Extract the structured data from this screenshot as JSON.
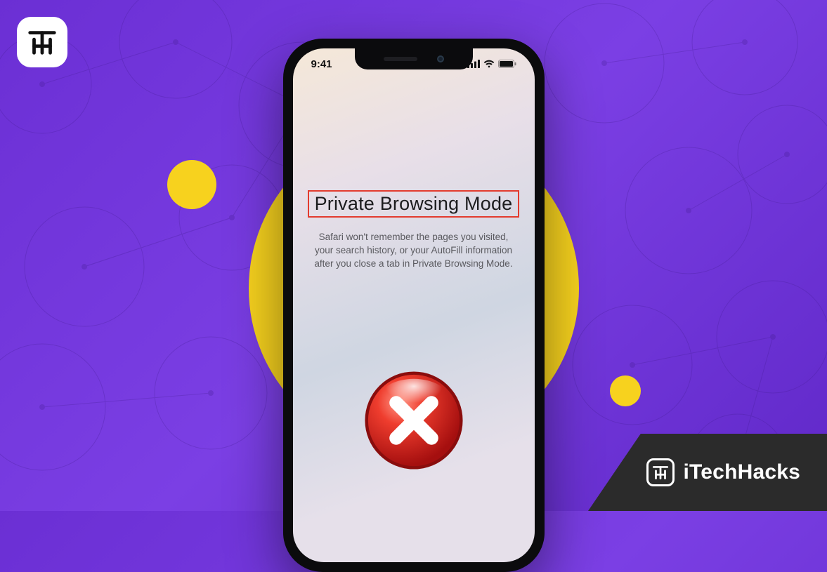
{
  "status_bar": {
    "time": "9:41"
  },
  "private": {
    "title": "Private Browsing Mode",
    "description": "Safari won't remember the pages you visited, your search history, or your AutoFill information after you close a tab in Private Browsing Mode."
  },
  "brand": {
    "name": "iTechHacks"
  }
}
